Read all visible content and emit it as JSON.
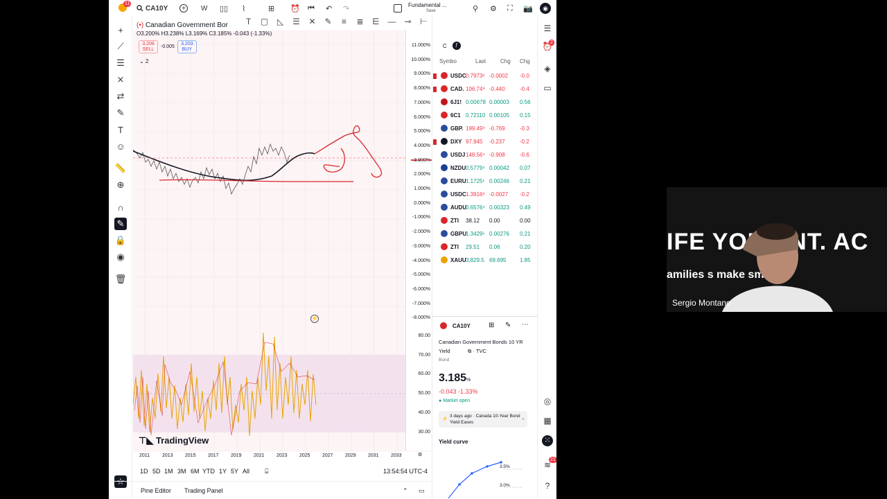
{
  "topbar": {
    "notif_count": "11",
    "symbol": "CA10Y",
    "interval": "W",
    "layout_name": "Fundamental ...",
    "layout_sub": "Save"
  },
  "legend": {
    "title": "Canadian Government Bor",
    "ohlc": "O3.200% H3.238% L3.169% C3.185% -0.043 (-1.33%)",
    "sell_price": "3.208",
    "sell_label": "SELL",
    "spread": "-0.005",
    "buy_price": "3.203",
    "buy_label": "BUY",
    "indicator_count": "2"
  },
  "price_axis": {
    "labels": [
      "11.000%",
      "10.000%",
      "9.000%",
      "8.000%",
      "7.000%",
      "6.000%",
      "5.000%",
      "4.000%",
      "3.000%",
      "2.000%",
      "1.000%",
      "0.000%",
      "-1.000%",
      "-2.000%",
      "-3.000%",
      "-4.000%",
      "-5.000%",
      "-6.000%",
      "-7.000%",
      "-8.000%"
    ],
    "current": "3.185%",
    "current_sub": "4d 4h",
    "rsi_labels": [
      "80.00",
      "70.00",
      "60.00",
      "50.00",
      "40.00",
      "30.00"
    ]
  },
  "time_axis": [
    "2011",
    "2013",
    "2015",
    "2017",
    "2019",
    "2021",
    "2023",
    "2025",
    "2027",
    "2029",
    "2031",
    "2033"
  ],
  "watermark": "TradingView",
  "ranges": [
    "1D",
    "5D",
    "1M",
    "3M",
    "6M",
    "YTD",
    "1Y",
    "5Y",
    "All"
  ],
  "clock": "13:54:54 UTC-4",
  "bottom_tabs": [
    "Pine Editor",
    "Trading Panel"
  ],
  "watchlist": {
    "list_letter": "C",
    "columns": [
      "Symbo",
      "Last",
      "Chg",
      "Chg"
    ],
    "rows": [
      {
        "sym": "USDC",
        "last": "0.7973²",
        "chg": "-0.0002",
        "chgp": "-0.0",
        "dir": "neg",
        "color": "#d9262b"
      },
      {
        "sym": "CAD.",
        "last": "106.74⁹",
        "chg": "-0.440",
        "chgp": "-0.4",
        "dir": "neg",
        "color": "#d9262b"
      },
      {
        "sym": "6J1!",
        "last": "0.00678",
        "chg": "0.00003",
        "chgp": "0.56",
        "dir": "pos",
        "color": "#c4141b"
      },
      {
        "sym": "6C1",
        "last": "0.72110",
        "chg": "0.00105",
        "chgp": "0.15",
        "dir": "pos",
        "color": "#d9262b"
      },
      {
        "sym": "GBP.",
        "last": "199.49⁹",
        "chg": "-0.769",
        "chgp": "-0.3",
        "dir": "neg",
        "color": "#2b4c9b"
      },
      {
        "sym": "DXY",
        "last": "97.945",
        "chg": "-0.237",
        "chgp": "-0.2",
        "dir": "neg",
        "color": "#131722"
      },
      {
        "sym": "USDJ",
        "last": "148.56⁴",
        "chg": "-0.908",
        "chgp": "-0.6",
        "dir": "neg",
        "color": "#2b4c9b"
      },
      {
        "sym": "NZDU",
        "last": "0.5779⁴",
        "chg": "0.00042",
        "chgp": "0.07",
        "dir": "pos",
        "color": "#1c3f94"
      },
      {
        "sym": "EURU",
        "last": "1.1725¹",
        "chg": "0.00246",
        "chgp": "0.21",
        "dir": "pos",
        "color": "#2b4c9b"
      },
      {
        "sym": "USDC",
        "last": "1.3916⁸",
        "chg": "-0.0027",
        "chgp": "-0.2",
        "dir": "neg",
        "color": "#2b4c9b"
      },
      {
        "sym": "AUDU",
        "last": "0.6576⁴",
        "chg": "0.00323",
        "chgp": "0.49",
        "dir": "pos",
        "color": "#2b4c9b"
      },
      {
        "sym": "ZTI",
        "last": "38.12",
        "chg": "0.00",
        "chgp": "0.00",
        "dir": "flat",
        "color": "#d9262b"
      },
      {
        "sym": "GBPU",
        "last": "1.3429⁵",
        "chg": "0.00276",
        "chgp": "0.21",
        "dir": "pos",
        "color": "#2b4c9b"
      },
      {
        "sym": "ZTI",
        "last": "29.51",
        "chg": "0.06",
        "chgp": "0.20",
        "dir": "pos",
        "color": "#d9262b"
      },
      {
        "sym": "XAUU",
        "last": "3,829.5",
        "chg": "69.695",
        "chgp": "1.85",
        "dir": "pos",
        "color": "#e8a400"
      }
    ]
  },
  "details": {
    "symbol": "CA10Y",
    "name": "Canadian Government Bonds 10 YR Yield",
    "source": "TVC",
    "type": "Bond",
    "price": "3.185",
    "unit": "%",
    "change": "-0.043  -1.33%",
    "market_status": "Market open",
    "news": "3 days ago · Canada 10-Year Bond Yield Eases",
    "yield_curve_title": "Yield curve",
    "yc_labels": [
      "3.5%",
      "3.0%"
    ]
  },
  "webcam": {
    "banner_big": "IFE YOU  ANT. AC",
    "banner_mid": "amilies          s make smart",
    "name": "Sergio Montano"
  },
  "colors": {
    "up": "#089981",
    "down": "#f23645",
    "accent": "#2962ff",
    "drawing": "#d9262b"
  }
}
